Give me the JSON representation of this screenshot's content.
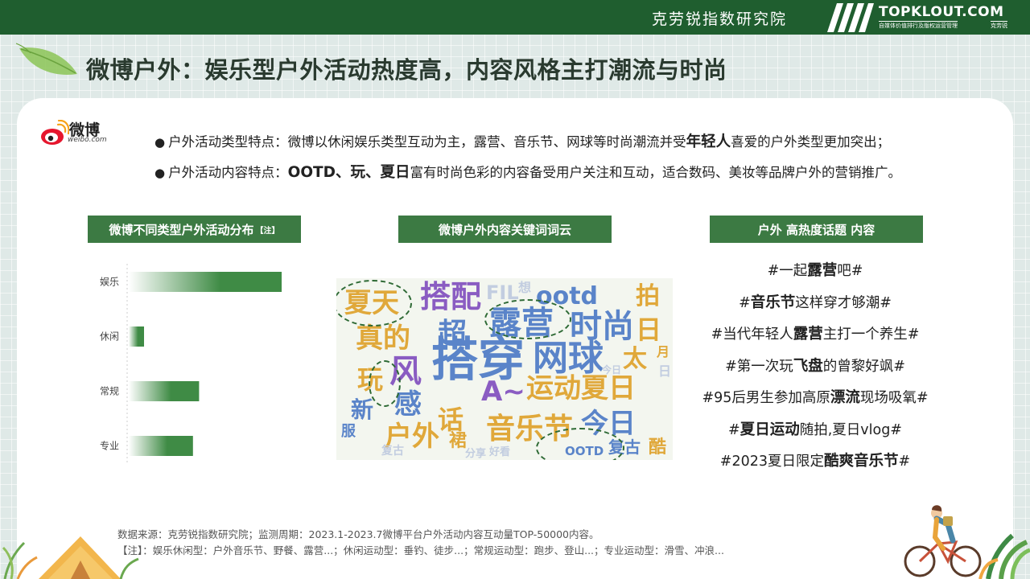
{
  "header": {
    "org_name": "克劳锐指数研究院",
    "brand_name": "TOPKLOUT.COM",
    "brand_tagline": "自媒体价值排行及版权运营管理",
    "brand_cn": "克劳锐"
  },
  "title": "微博户外：娱乐型户外活动热度高，内容风格主打潮流与时尚",
  "weibo_logo": {
    "cn": "微博",
    "en": "weibo.com"
  },
  "bullets": [
    {
      "dot": "●",
      "pre": "户外活动类型特点：微博以休闲娱乐类型互动为主，露营、音乐节、网球等时尚潮流并受",
      "bold": "年轻人",
      "post": "喜爱的户外类型更加突出；"
    },
    {
      "dot": "●",
      "pre": "户外活动内容特点：",
      "bold": "OOTD、玩、夏日",
      "post": "富有时尚色彩的内容备受用户关注和互动，适合数码、美妆等品牌户外的营销推广。"
    }
  ],
  "sections": {
    "distribution": {
      "title": "微博不同类型户外活动分布",
      "note": "【注】"
    },
    "wordcloud": {
      "title": "微博户外内容关键词词云"
    },
    "topics": {
      "title": "户外 高热度话题 内容"
    }
  },
  "chart_data": {
    "type": "bar",
    "orientation": "horizontal",
    "categories": [
      "娱乐",
      "休闲",
      "常规",
      "专业"
    ],
    "values": [
      100,
      10,
      46,
      42
    ],
    "colors": {
      "bar_end": "#3f8b45",
      "bar_start": "#ffffff"
    },
    "title": "",
    "xlabel": "",
    "ylabel": ""
  },
  "wordcloud_words": [
    {
      "text": "搭穿",
      "color": "#5a84c9"
    },
    {
      "text": "露营",
      "color": "#5a84c9"
    },
    {
      "text": "网球",
      "color": "#5a84c9"
    },
    {
      "text": "时尚",
      "color": "#5a84c9"
    },
    {
      "text": "运动夏日",
      "color": "#e0a83a"
    },
    {
      "text": "音乐节",
      "color": "#e0a83a"
    },
    {
      "text": "今日",
      "color": "#5a84c9"
    },
    {
      "text": "搭配",
      "color": "#8a5cc2"
    },
    {
      "text": "夏天",
      "color": "#e0a83a"
    },
    {
      "text": "真的",
      "color": "#e0a83a"
    },
    {
      "text": "超",
      "color": "#5a84c9"
    },
    {
      "text": "风",
      "color": "#8a5cc2"
    },
    {
      "text": "玩",
      "color": "#e0a83a"
    },
    {
      "text": "感",
      "color": "#5a84c9"
    },
    {
      "text": "话",
      "color": "#e0a83a"
    },
    {
      "text": "户外",
      "color": "#e0a83a"
    },
    {
      "text": "A~",
      "color": "#8a5cc2"
    },
    {
      "text": "太",
      "color": "#e0a83a"
    },
    {
      "text": "拍",
      "color": "#e0a83a"
    },
    {
      "text": "日",
      "color": "#e0a83a"
    },
    {
      "text": "ootd",
      "color": "#5a84c9"
    },
    {
      "text": "OOTD",
      "color": "#5a84c9"
    },
    {
      "text": "复古",
      "color": "#5a84c9"
    },
    {
      "text": "酷",
      "color": "#e0a83a"
    },
    {
      "text": "新",
      "color": "#5a84c9"
    },
    {
      "text": "服",
      "color": "#5a84c9"
    },
    {
      "text": "裙",
      "color": "#e0a83a"
    },
    {
      "text": "月",
      "color": "#e0a83a"
    },
    {
      "text": "FIL",
      "color": "#c2cde0"
    },
    {
      "text": "想",
      "color": "#c2cde0"
    },
    {
      "text": "好看",
      "color": "#c2cde0"
    },
    {
      "text": "分享",
      "color": "#c2cde0"
    },
    {
      "text": "复古",
      "color": "#c2cde0"
    },
    {
      "text": "今日",
      "color": "#c2cde0"
    },
    {
      "text": "日",
      "color": "#c2cde0"
    }
  ],
  "topics": [
    {
      "pre": "#一起",
      "bold": "露营",
      "post": "吧#"
    },
    {
      "pre": "#",
      "bold": "音乐节",
      "post": "这样穿才够潮#"
    },
    {
      "pre": "#当代年轻人",
      "bold": "露营",
      "post": "主打一个养生#"
    },
    {
      "pre": "#第一次玩",
      "bold": "飞盘",
      "post": "的曾黎好飒#"
    },
    {
      "pre": "#95后男生参加高原",
      "bold": "漂流",
      "post": "现场吸氧#"
    },
    {
      "pre": "#",
      "bold": "夏日运动",
      "post": "随拍,夏日vlog#"
    },
    {
      "pre": "#2023夏日限定",
      "bold": "酷爽音乐节",
      "post": "#"
    }
  ],
  "source": {
    "line1": "数据来源：克劳锐指数研究院；监测周期：2023.1-2023.7微博平台户外活动内容互动量TOP-50000内容。",
    "line2": "【注】：娱乐休闲型：户外音乐节、野餐、露营...；休闲运动型：垂钓、徒步...；常规运动型：跑步、登山...；专业运动型：滑雪、冲浪..."
  },
  "colors": {
    "primary_green": "#1f5e2f",
    "section_green": "#3c7a43",
    "ring_green": "#2e6a35"
  }
}
